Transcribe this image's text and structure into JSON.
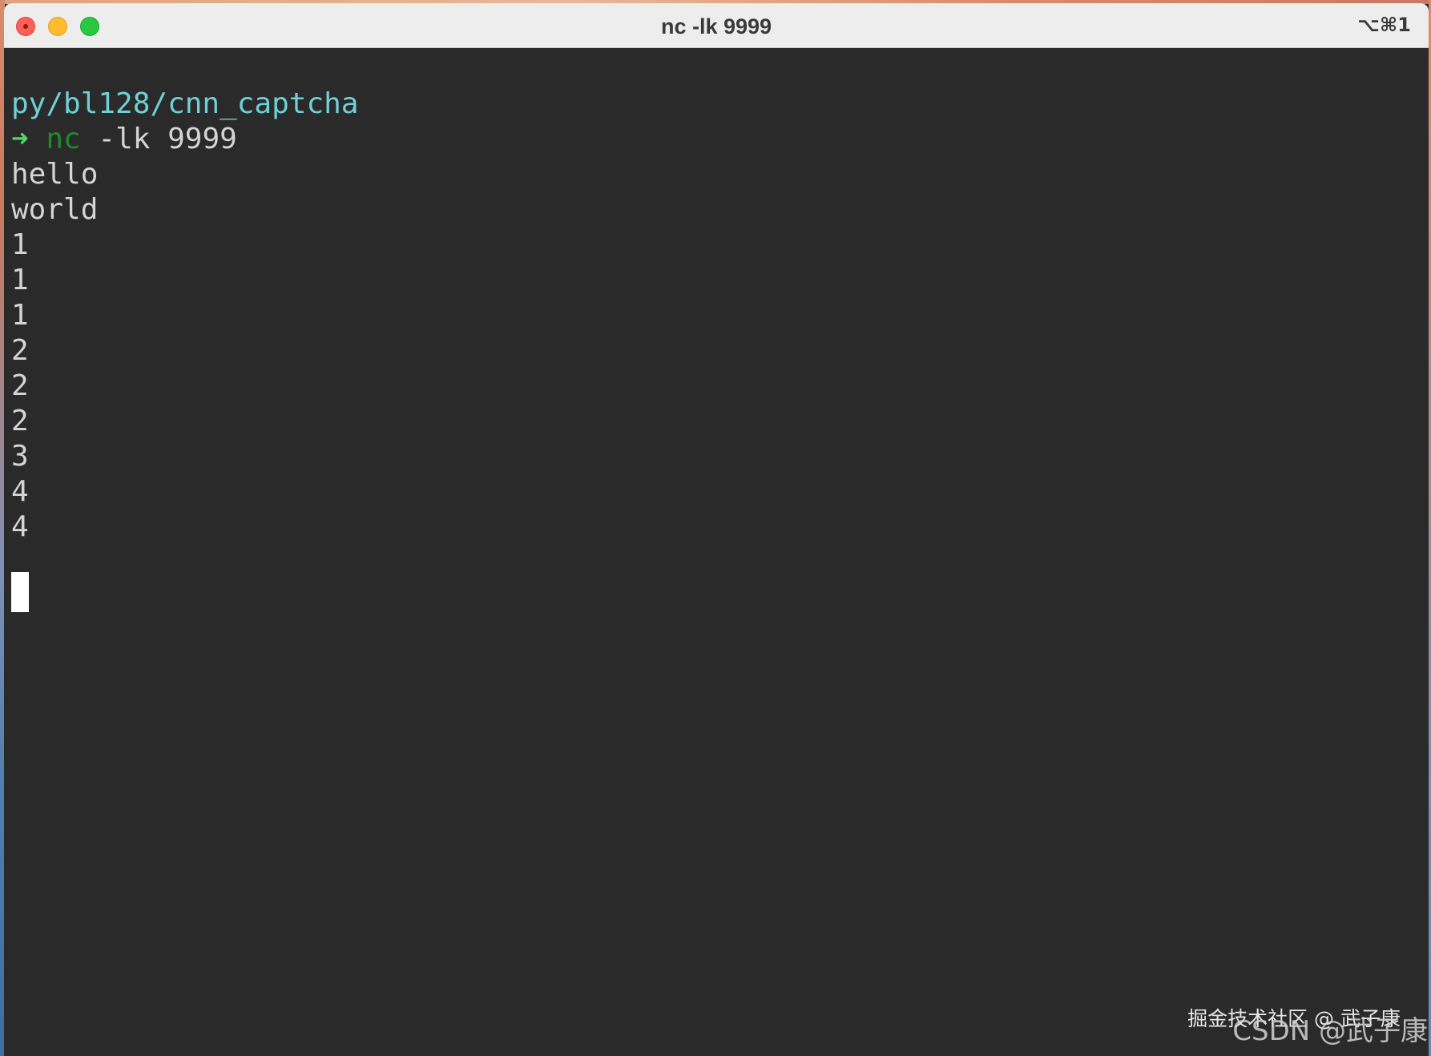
{
  "window": {
    "title": "nc -lk 9999",
    "shortcut": "⌥⌘1"
  },
  "terminal": {
    "path": "py/bl128/cnn_captcha",
    "prompt_arrow": "➜",
    "command": "nc",
    "command_args": "-lk 9999",
    "output": [
      "hello",
      "world",
      "1",
      "1",
      "1",
      "2",
      "2",
      "2",
      "3",
      "4",
      "4"
    ]
  },
  "watermarks": {
    "juejin": "掘金技术社区 @ 武子康",
    "csdn": "CSDN @武子康"
  },
  "colors": {
    "terminal_bg": "#2a2a2a",
    "path": "#6fd0d6",
    "prompt_arrow": "#4cd964",
    "command": "#1f8a2c",
    "text": "#d4d4d4"
  }
}
